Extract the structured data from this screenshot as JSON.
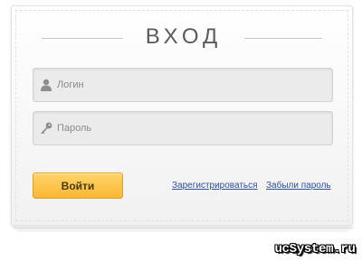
{
  "form": {
    "title": "ВХОД",
    "login_placeholder": "Логин",
    "password_placeholder": "Пароль",
    "submit_label": "Войти",
    "register_link": "Зарегистрироваться",
    "forgot_link": "Забыли пароль",
    "login_icon": "user-icon",
    "password_icon": "key-icon"
  },
  "colors": {
    "button_top": "#ffd56a",
    "button_bottom": "#f9b733",
    "link": "#2f4f9c",
    "field_bg": "#ebebeb"
  },
  "watermark": {
    "text": "ucSystem.ru"
  }
}
